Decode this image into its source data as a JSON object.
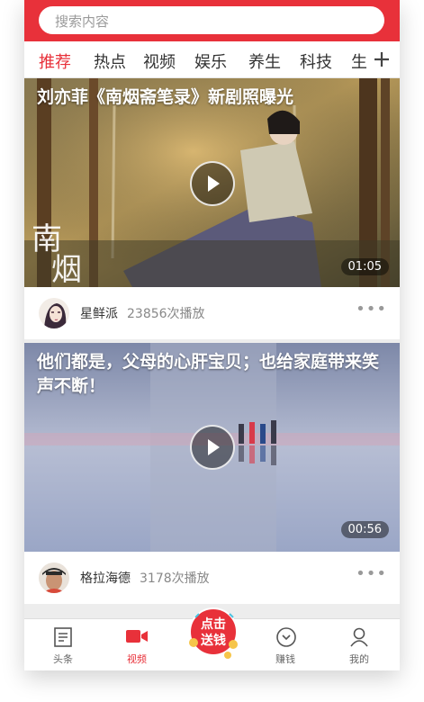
{
  "search": {
    "placeholder": "搜索内容"
  },
  "tabs": [
    {
      "label": "推荐",
      "active": true
    },
    {
      "label": "热点"
    },
    {
      "label": "视频"
    },
    {
      "label": "娱乐"
    },
    {
      "label": "养生"
    },
    {
      "label": "科技"
    },
    {
      "label": "生"
    }
  ],
  "plus_icon": "plus-icon",
  "feed": [
    {
      "title": "刘亦菲《南烟斋笔录》新剧照曝光",
      "duration": "01:05",
      "author": "星鲜派",
      "plays": "23856次播放",
      "watermark": "南烟斋笔录"
    },
    {
      "title": "他们都是，父母的心肝宝贝；也给家庭带来笑声不断！",
      "duration": "00:56",
      "author": "格拉海德",
      "plays": "3178次播放"
    }
  ],
  "more_glyph": "•••",
  "bottom_nav": [
    {
      "label": "头条",
      "icon": "news-icon"
    },
    {
      "label": "视频",
      "icon": "video-icon",
      "active": true
    },
    {
      "label": "赚钱",
      "icon": "coin-icon"
    },
    {
      "label": "我的",
      "icon": "user-icon"
    }
  ],
  "promo": {
    "line1": "点击",
    "line2": "送钱"
  },
  "colors": {
    "brand": "#e8313a"
  }
}
